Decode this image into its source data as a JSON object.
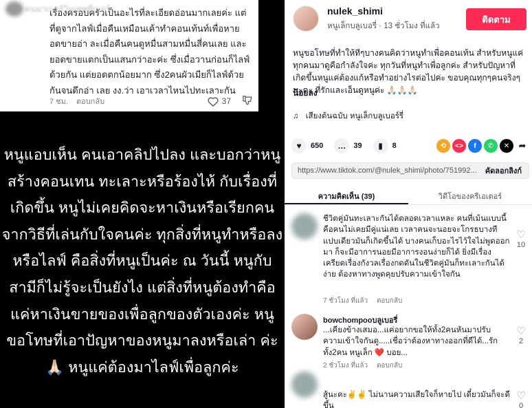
{
  "left": {
    "card": {
      "user": "คนมาเบอร์วินเทพที่เบอร์",
      "text": "เรื่องครอบครัวเป็นอะไรที่ละเอียดอ่อนมากเลยค่ะ แต่ที่ดูจากไลฟ์เมื่อคืนเหมือนเค้าทำคอนเท้นท์เพื่อหายอดขายอ่า ละเมื่อคืนคนดูหมื่นสามหมื่นสี่คนเลย และยอดขายแตกเป็นแสนกว่าอะค่ะ ซึ่งเมื่อวานก่อนก็ไลฟ์ด้วยกัน แต่ยอดตกน้อยมาก ซึ่ง2คนผัวเมียก็ไลฟ์ด้วยกันจนดึกอ่า เลย งง.ว่า เอาเวลาไหนไปทะเลาะกัน",
      "time": "7 ชม.",
      "reply": "ตอบกลับ",
      "likes": "37"
    },
    "story": "หนูแอบเห็น คนเอาคลิปไปลง และบอกว่าหนูสร้างคอนเทน ทะเลาะหรือร้องไห้ กับเรื่องที่เกิดขึ้น หนูไม่เคยคิดจะหาเงินหรือเรียกคนจากวิธีที่เล่นกับใจคนค่ะ ทุกสิ่งที่หนูทำหรือลง หรือไลฟ์ คือสิ่งที่หนูเป็นค่ะ ณ วันนี้ หนูกับสามีก็ไม่รู้จะเป็นยังไง แต่สิ่งที่หนูต้องทำคือแค่หาเงินขายของเพื่อลูกของตัวเองค่ะ หนูขอโทษที่เอาปัญหาของหนูมาลงหรือเล่า ค่ะ 🙏🏻 หนูแค่ต้องมาไลฟ์เพื่อลูกค่ะ"
  },
  "right": {
    "author": {
      "name": "nulek_shimi",
      "sub": "หนูเล็กบลูเบอรี่ · 13 ชั่วโมง ที่แล้ว",
      "follow": "ติดตาม"
    },
    "caption": "หนูขอโทษที่ทำให้ทีๆบางคนคิดว่าหนูทำเพื่อคอนเท้น สำหรับหนูแค่ทุกคนมาดูคือกำลังใจค่ะ ทุกวันที่หนูทำเพื่อลูกค่ะ สำหรับปัญหาที่เกิดขึ้นหนูแค่ต้องแก้หรือทำอย่างไรต่อไปค่ะ ขอบคุณทุกๆคนจริงๆนะคะ ที่รักและเอ็นดูหนูค่ะ 🙏🏻🙏🏻🙏🏻",
    "caption_end": "น้อยลง",
    "music": "เสียงต้นฉบับ  หนูเล็กบลูเบอร์รี่",
    "actions": {
      "likes": "650",
      "comments": "39",
      "saves": "8"
    },
    "link": {
      "url": "https://www.tiktok.com/@nulek_shimi/photo/751992...",
      "copy": "คัดลอกลิงก์"
    },
    "tabs": [
      "ความคิดเห็น (39)",
      "วิดีโอของครีเอเตอร์"
    ],
    "comments": [
      {
        "user": "",
        "text": "ชีวิตคู่มันทะเลาะกันได้ตลอดเวลาแหละ คนที่เม้นแบบนี้คือคนไม่เคยมีคู่แน่เลย เวลาคนจะนอยจะโกรธบางทีแปบเดียวมันก็เกิดขึ้นได้ บางคนเก็บอะไรไว้ใจไม่พูดออกมา ก็จะมีอาการนอยมีอาการงอนง่ายก็ได้ ยิ่งมีเรื่องเครียดเรื่องกังวลเรื่องกดดันในชีวิตคู่มันก็ทะเลาะกันได้ง่าย ต้องหาทางพูดคุยปรับความเข้าใจกัน",
        "time": "7 ชั่วโมง ที่แล้ว",
        "reply": "ตอบกลับ",
        "likes": "10"
      },
      {
        "user": "bowchompooบลูเบอรี่",
        "text": "...เคียงข้างเสมอ...แค่อยากขอให้ทั้ง2คนหันมาปรับความเข้าใจกันดู.....เชื่อว่าต้องหาทางออกที่ดีได้...รักทั้ง2คน หนูเล็ก ❤️ บอย...",
        "time": "2 ชั่วโมง ที่แล้ว",
        "reply": "ตอบกลับ",
        "likes": "2"
      },
      {
        "user": "",
        "text": "สู้นะคะ✌️✌️ ไม่นานความเสียใจก็หายไป เดี๋ยวมันก็จะดีขึ้น",
        "likes": "0"
      }
    ]
  }
}
